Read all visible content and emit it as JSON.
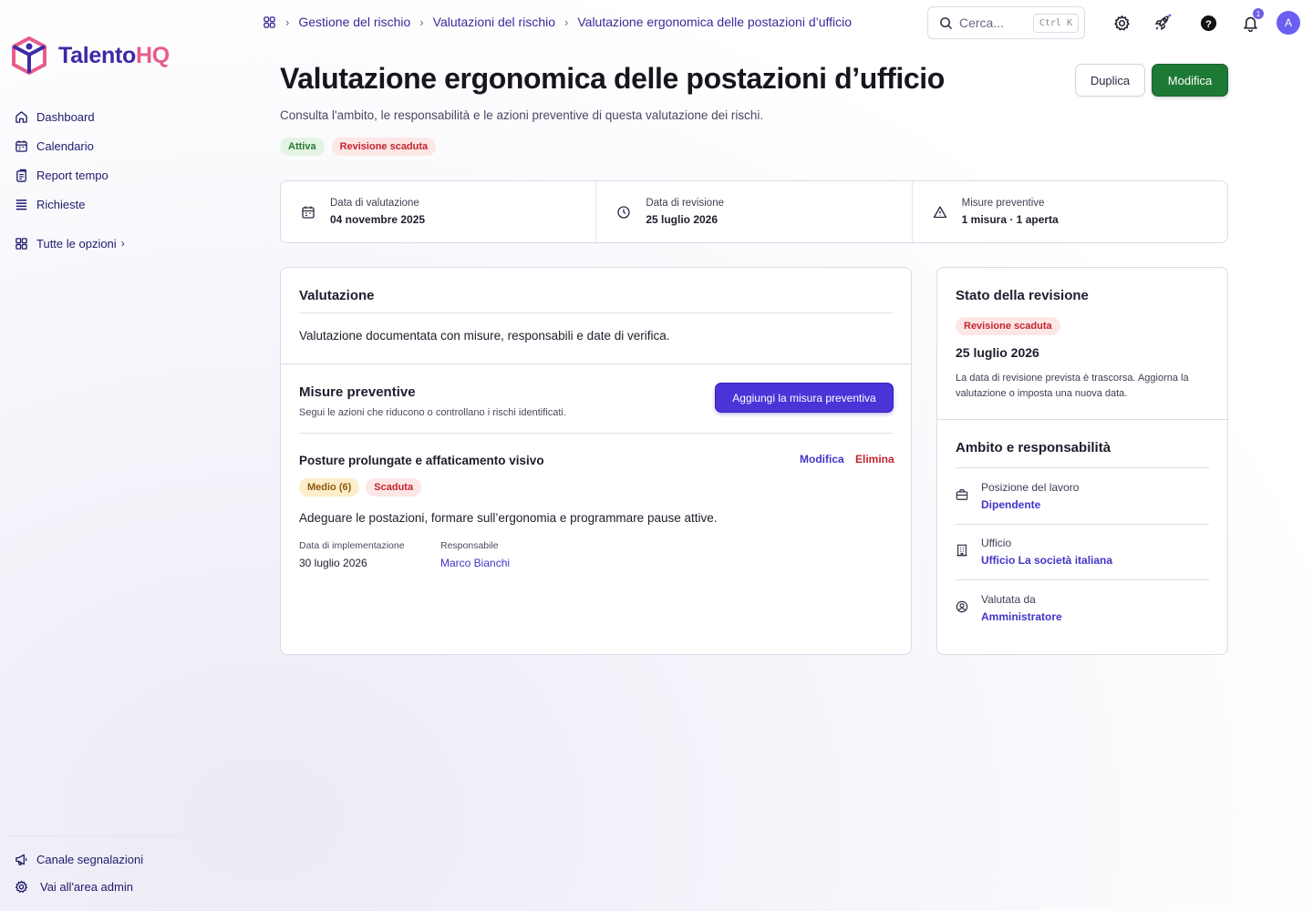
{
  "brand": {
    "name_part1": "Talento",
    "name_part2": "HQ",
    "color1": "#3b2aa8",
    "color2": "#e85b8a"
  },
  "sidebar": {
    "items": [
      {
        "label": "Dashboard",
        "icon": "home-icon"
      },
      {
        "label": "Calendario",
        "icon": "calendar-icon"
      },
      {
        "label": "Report tempo",
        "icon": "report-icon"
      },
      {
        "label": "Richieste",
        "icon": "list-icon"
      }
    ],
    "all_options": "Tutte le opzioni",
    "bottom": [
      {
        "label": "Canale segnalazioni",
        "icon": "megaphone-icon"
      },
      {
        "label": "Vai all'area admin",
        "icon": "gear-icon"
      }
    ]
  },
  "breadcrumb": [
    "Gestione del rischio",
    "Valutazioni del rischio",
    "Valutazione ergonomica delle postazioni d’ufficio"
  ],
  "search": {
    "placeholder": "Cerca...",
    "shortcut": "Ctrl K"
  },
  "notifications": {
    "count": "1"
  },
  "user": {
    "initial": "A"
  },
  "page": {
    "title": "Valutazione ergonomica delle postazioni d’ufficio",
    "subtitle": "Consulta l'ambito, le responsabilità e le azioni preventive di questa valutazione dei rischi.",
    "tags": [
      "Attiva",
      "Revisione scaduta"
    ],
    "duplicate_label": "Duplica",
    "edit_label": "Modifica"
  },
  "stats": [
    {
      "label": "Data di valutazione",
      "value": "04 novembre 2025",
      "icon": "calendar-icon"
    },
    {
      "label": "Data di revisione",
      "value": "25 luglio 2026",
      "icon": "clock-icon"
    },
    {
      "label": "Misure preventive",
      "value": "1 misura · 1 aperta",
      "icon": "warning-icon"
    }
  ],
  "evaluation": {
    "title": "Valutazione",
    "text": "Valutazione documentata con misure, responsabili e date di verifica."
  },
  "measures": {
    "title": "Misure preventive",
    "subtitle": "Segui le azioni che riducono o controllano i rischi identificati.",
    "add_label": "Aggiungi la misura preventiva",
    "item": {
      "title": "Posture prolungate e affaticamento visivo",
      "edit": "Modifica",
      "delete": "Elimina",
      "badges": [
        "Medio (6)",
        "Scaduta"
      ],
      "description": "Adeguare le postazioni, formare sull’ergonomia e programmare pause attive.",
      "impl_label": "Data di implementazione",
      "impl_value": "30 luglio 2026",
      "owner_label": "Responsabile",
      "owner_value": "Marco Bianchi"
    }
  },
  "review": {
    "title": "Stato della revisione",
    "badge": "Revisione scaduta",
    "date": "25 luglio 2026",
    "text": "La data di revisione prevista è trascorsa. Aggiorna la valutazione o imposta una nuova data."
  },
  "scope": {
    "title": "Ambito e responsabilità",
    "rows": [
      {
        "label": "Posizione del lavoro",
        "value": "Dipendente",
        "icon": "briefcase-icon"
      },
      {
        "label": "Ufficio",
        "value": "Ufficio La società italiana",
        "icon": "building-icon"
      },
      {
        "label": "Valutata da",
        "value": "Amministratore",
        "icon": "user-circle-icon"
      }
    ]
  }
}
